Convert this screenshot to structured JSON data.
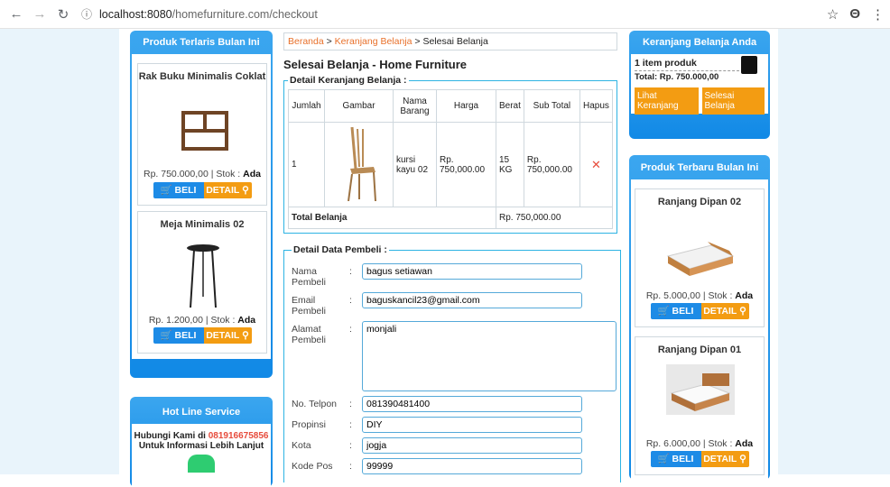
{
  "browser": {
    "url_host": "localhost:8080",
    "url_path": "/homefurniture.com/checkout"
  },
  "left": {
    "best_title": "Produk Terlaris Bulan Ini",
    "products": [
      {
        "name": "Rak Buku Minimalis Coklat",
        "price": "Rp. 750.000,00 | Stok : ",
        "stock": "Ada"
      },
      {
        "name": "Meja Minimalis 02",
        "price": "Rp. 1.200,00 | Stok : ",
        "stock": "Ada"
      }
    ],
    "buy_label": "BELI",
    "detail_label": "DETAIL",
    "hotline_title": "Hot Line Service",
    "hotline_text1": "Hubungi Kami di ",
    "hotline_phone": "081916675856",
    "hotline_text2": "Untuk Informasi Lebih Lanjut"
  },
  "center": {
    "breadcrumb": {
      "home": "Beranda",
      "cart": "Keranjang Belanja",
      "current": "Selesai Belanja"
    },
    "title": "Selesai Belanja - Home Furniture",
    "cart_legend": "Detail Keranjang Belanja :",
    "columns": [
      "Jumlah",
      "Gambar",
      "Nama Barang",
      "Harga",
      "Berat",
      "Sub Total",
      "Hapus"
    ],
    "rows": [
      {
        "qty": "1",
        "name": "kursi kayu 02",
        "price": "Rp. 750,000.00",
        "weight": "15 KG",
        "subtotal": "Rp. 750,000.00",
        "delete": "✕"
      }
    ],
    "total_label": "Total Belanja",
    "total_value": "Rp. 750,000.00",
    "buyer_legend": "Detail Data Pembeli :",
    "fields": {
      "name": {
        "label": "Nama Pembeli",
        "value": "bagus setiawan"
      },
      "email": {
        "label": "Email Pembeli",
        "value": "baguskancil23@gmail.com"
      },
      "address": {
        "label": "Alamat Pembeli",
        "value": "monjali"
      },
      "phone": {
        "label": "No. Telpon",
        "value": "081390481400"
      },
      "province": {
        "label": "Propinsi",
        "value": "DIY"
      },
      "city": {
        "label": "Kota",
        "value": "jogja"
      },
      "postal": {
        "label": "Kode Pos",
        "value": "99999"
      }
    }
  },
  "right": {
    "cart_title": "Keranjang Belanja Anda",
    "item_count": "1 item produk",
    "total": "Total: Rp. 750.000,00",
    "view_cart": "Lihat Keranjang",
    "finish": "Selesai Belanja",
    "new_title": "Produk Terbaru Bulan Ini",
    "products": [
      {
        "name": "Ranjang Dipan 02",
        "price": "Rp. 5.000,00 | Stok : ",
        "stock": "Ada"
      },
      {
        "name": "Ranjang Dipan 01",
        "price": "Rp. 6.000,00 | Stok : ",
        "stock": "Ada"
      }
    ]
  }
}
